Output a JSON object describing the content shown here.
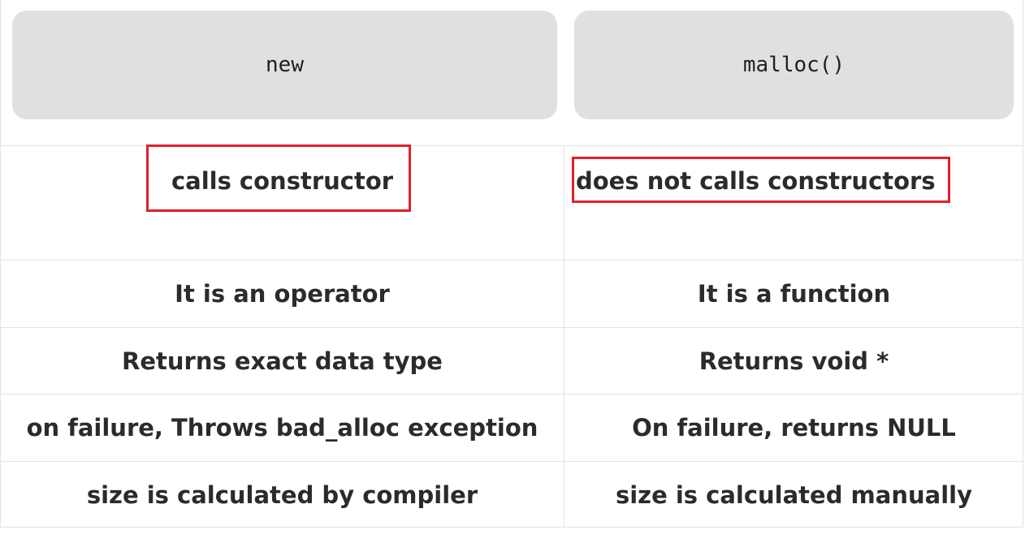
{
  "table": {
    "headers": [
      "new",
      "malloc()"
    ],
    "rows": [
      [
        "calls constructor",
        "does not calls constructors"
      ],
      [
        "It is an operator",
        "It is a function"
      ],
      [
        "Returns exact data type",
        "Returns void *"
      ],
      [
        "on failure, Throws bad_alloc exception",
        "On failure, returns NULL"
      ],
      [
        "size is calculated by compiler",
        "size is calculated manually"
      ]
    ]
  },
  "colors": {
    "header_bg": "#e0e0e0",
    "highlight": "#e0202a",
    "border": "#e3e3e3",
    "text": "#2b2b2b"
  }
}
